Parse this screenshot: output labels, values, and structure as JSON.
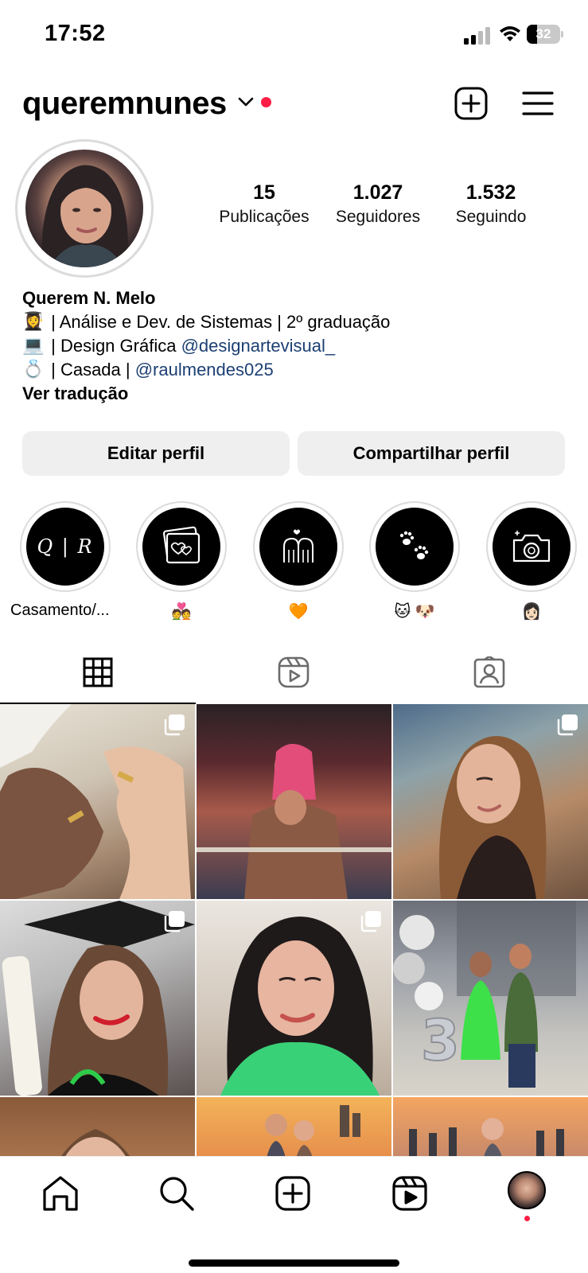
{
  "status_bar": {
    "time": "17:52",
    "battery_percent": "32",
    "battery_level": 0.32
  },
  "header": {
    "username": "queremnunes",
    "icons": [
      "chevron-down-icon",
      "new-post-icon",
      "menu-icon"
    ]
  },
  "profile": {
    "stats": [
      {
        "value": "15",
        "label": "Publicações"
      },
      {
        "value": "1.027",
        "label": "Seguidores"
      },
      {
        "value": "1.532",
        "label": "Seguindo"
      }
    ],
    "name": "Querem N. Melo",
    "bio_lines": [
      {
        "emoji": "👩‍🎓",
        "text": " | Análise e Dev. de Sistemas | 2º graduação",
        "mention": ""
      },
      {
        "emoji": "💻",
        "text": " | Design Gráfica ",
        "mention": "@designartevisual_"
      },
      {
        "emoji": "💍",
        "text": " | Casada | ",
        "mention": "@raulmendes025"
      }
    ],
    "see_translation": "Ver tradução"
  },
  "actions": {
    "edit": "Editar perfil",
    "share": "Compartilhar perfil"
  },
  "highlights": [
    {
      "label": "Casamento/...",
      "cover_text": "Q | R",
      "icon": "monogram-icon"
    },
    {
      "label": "💑",
      "cover_text": "",
      "icon": "photo-hearts-icon"
    },
    {
      "label": "🧡",
      "cover_text": "",
      "icon": "couple-icon"
    },
    {
      "label": "🐱 🐶",
      "cover_text": "",
      "icon": "paw-icon"
    },
    {
      "label": "👩🏻",
      "cover_text": "",
      "icon": "camera-icon"
    }
  ],
  "tabs": [
    "grid-icon",
    "reels-icon",
    "tagged-icon"
  ],
  "posts": [
    {
      "name": "post-rings",
      "multi": true
    },
    {
      "name": "post-party",
      "multi": false
    },
    {
      "name": "post-portrait-hair",
      "multi": true
    },
    {
      "name": "post-graduation",
      "multi": true
    },
    {
      "name": "post-selfie-green",
      "multi": true
    },
    {
      "name": "post-birthday-balloons",
      "multi": false
    },
    {
      "name": "post-portrait-3",
      "multi": false
    },
    {
      "name": "post-sunset-couple",
      "multi": false
    },
    {
      "name": "post-crowd",
      "multi": false
    }
  ],
  "bottom_nav": [
    "home-icon",
    "search-icon",
    "create-icon",
    "reels-icon",
    "profile-avatar"
  ]
}
